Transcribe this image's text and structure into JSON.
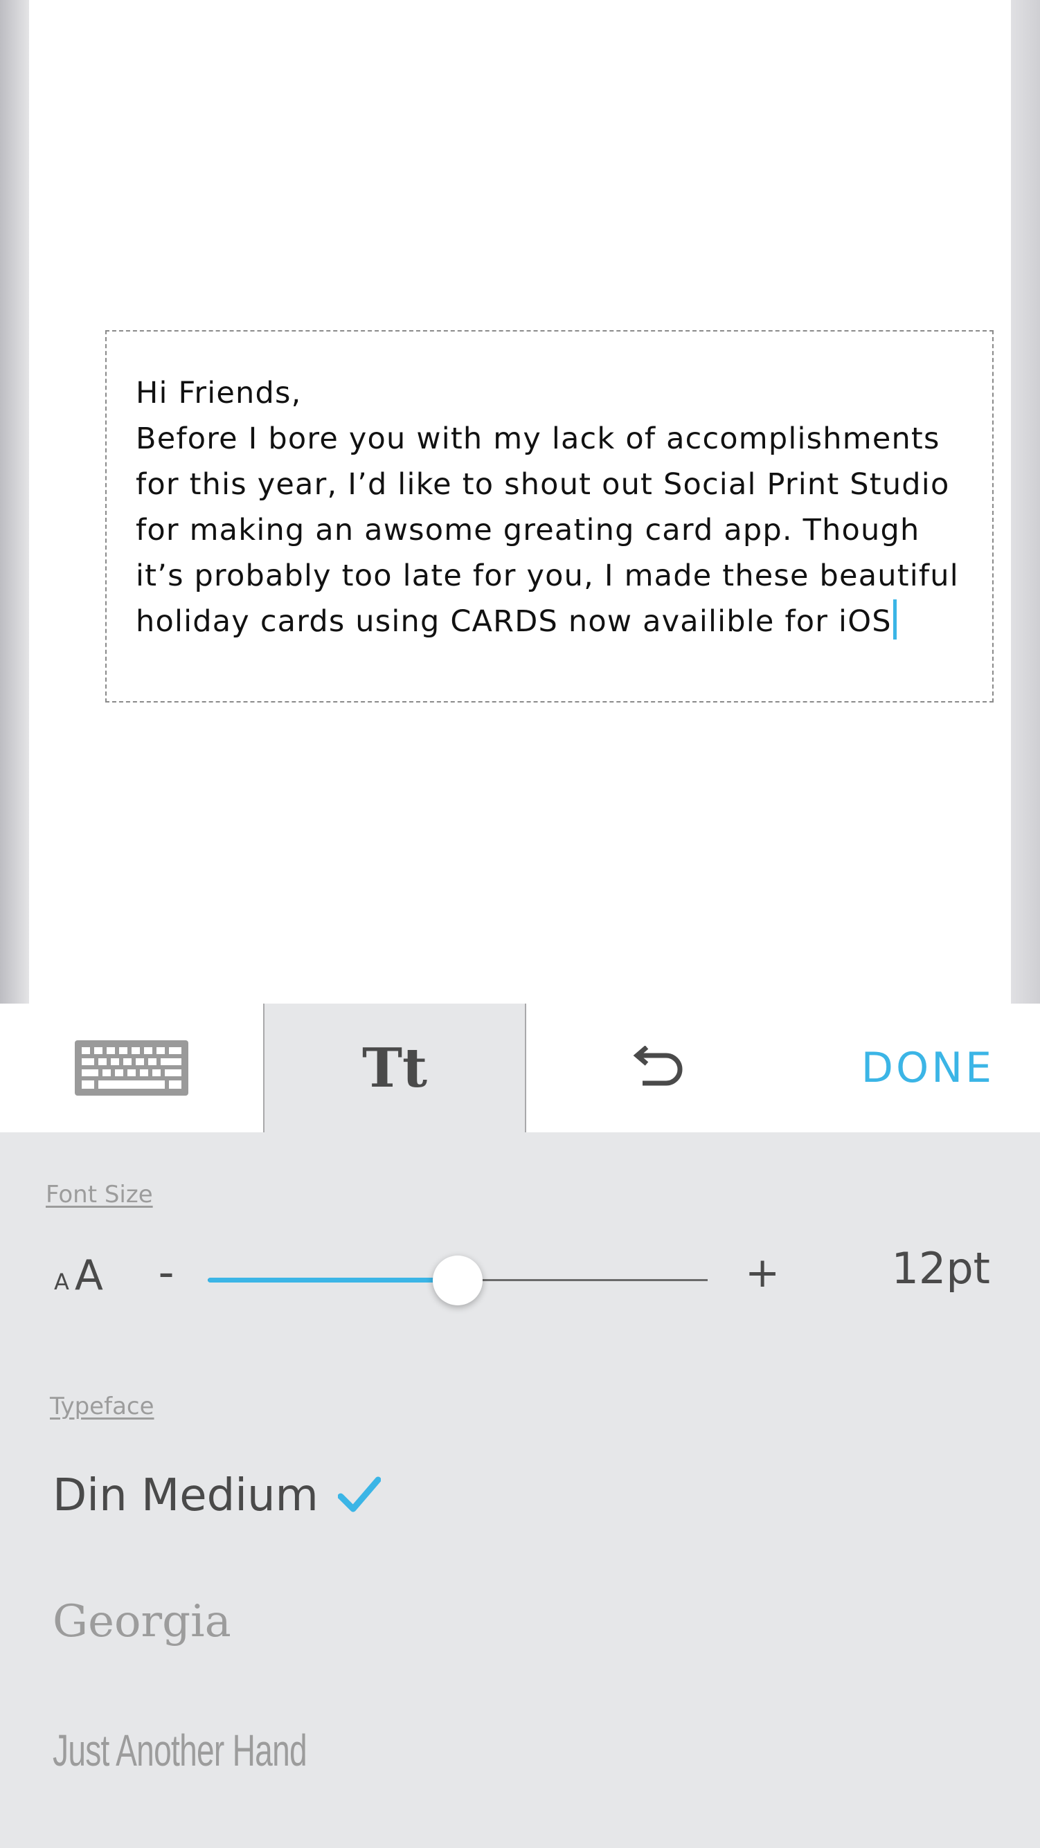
{
  "card": {
    "message_lines": [
      "Hi Friends,",
      "Before I bore you with my lack of accomplishments",
      "for this year, I’d like to shout out Social Print Studio",
      "for making an awsome greating card app. Though",
      "it’s probably too late for you, I made these beautiful",
      "holiday cards using CARDS now availible for iOS"
    ]
  },
  "toolbar": {
    "keyboard_icon": "keyboard-icon",
    "text_style_label": "Tt",
    "undo_icon": "undo-icon",
    "done_label": "DONE"
  },
  "panel": {
    "font_size": {
      "label": "Font Size",
      "small_a": "A",
      "big_a": "A",
      "minus": "-",
      "plus": "+",
      "slider_fraction": 0.5,
      "value": "12pt"
    },
    "typeface": {
      "label": "Typeface",
      "options": [
        {
          "name": "Din Medium",
          "selected": true
        },
        {
          "name": "Georgia",
          "selected": false
        },
        {
          "name": "Just Another Hand",
          "selected": false
        }
      ]
    }
  },
  "colors": {
    "accent": "#3bb5e6",
    "panel_bg": "#e6e7e9",
    "text_dark": "#4a4a4a",
    "text_muted": "#9c9c9c"
  }
}
